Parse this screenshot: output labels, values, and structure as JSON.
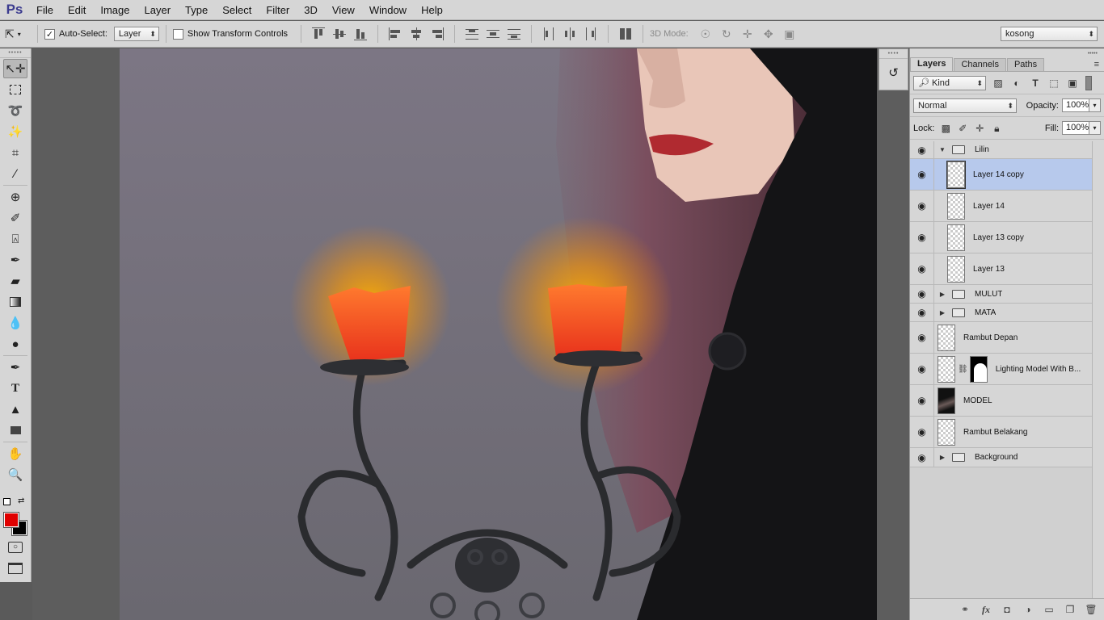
{
  "app": {
    "logo": "Ps",
    "menu": [
      "File",
      "Edit",
      "Image",
      "Layer",
      "Type",
      "Select",
      "Filter",
      "3D",
      "View",
      "Window",
      "Help"
    ]
  },
  "options": {
    "auto_select_label": "Auto-Select:",
    "auto_select_checked": "✓",
    "auto_select_value": "Layer",
    "show_transform_label": "Show Transform Controls",
    "mode3d_label": "3D Mode:",
    "workspace": "kosong"
  },
  "tools": {
    "type_preset": "A|"
  },
  "layers_panel": {
    "tabs": [
      "Layers",
      "Channels",
      "Paths"
    ],
    "filter_kind": "Kind",
    "blend_mode": "Normal",
    "opacity_label": "Opacity:",
    "opacity_value": "100%",
    "lock_label": "Lock:",
    "fill_label": "Fill:",
    "fill_value": "100%",
    "layers": [
      {
        "name": "Lilin",
        "type": "group-open"
      },
      {
        "name": "Layer 14 copy",
        "type": "layer",
        "selected": true
      },
      {
        "name": "Layer 14",
        "type": "layer"
      },
      {
        "name": "Layer 13 copy",
        "type": "layer"
      },
      {
        "name": "Layer 13",
        "type": "layer"
      },
      {
        "name": "MULUT",
        "type": "group"
      },
      {
        "name": "MATA",
        "type": "group"
      },
      {
        "name": "Rambut Depan",
        "type": "layer"
      },
      {
        "name": "Lighting Model With B...",
        "type": "masked"
      },
      {
        "name": "MODEL",
        "type": "image"
      },
      {
        "name": "Rambut Belakang",
        "type": "layer"
      },
      {
        "name": "Background",
        "type": "group"
      }
    ]
  },
  "colors": {
    "foreground": "#e00000",
    "background": "#000000",
    "selection": "#b7c9ec"
  }
}
